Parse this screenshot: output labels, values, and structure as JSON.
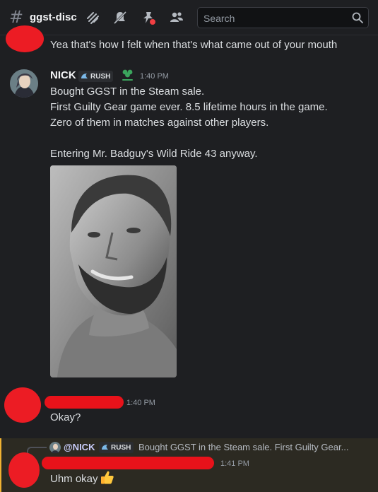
{
  "header": {
    "channel_name": "ggst-disc",
    "search_placeholder": "Search"
  },
  "messages": [
    {
      "text": "Yea that's how I felt when that's what came out of your mouth"
    },
    {
      "author": "NICK",
      "tag": "RUSH",
      "timestamp": "1:40 PM",
      "lines": [
        "Bought GGST in the Steam sale.",
        "First Guilty Gear game ever. 8.5 lifetime hours in the game.",
        "Zero of them in matches against other players.",
        "",
        "Entering Mr. Badguy's Wild Ride 43 anyway."
      ]
    },
    {
      "timestamp": "1:40 PM",
      "text": "Okay?"
    },
    {
      "reply": {
        "author": "@NICK",
        "tag": "RUSH",
        "preview": "Bought GGST in the Steam sale. First Guilty Gear..."
      },
      "timestamp": "1:41 PM",
      "text": "Uhm okay"
    }
  ],
  "colors": {
    "background": "#1e1f22",
    "mention_highlight": "#2c2a22",
    "mention_bar": "#f0b232",
    "redaction": "#ec1c24"
  }
}
